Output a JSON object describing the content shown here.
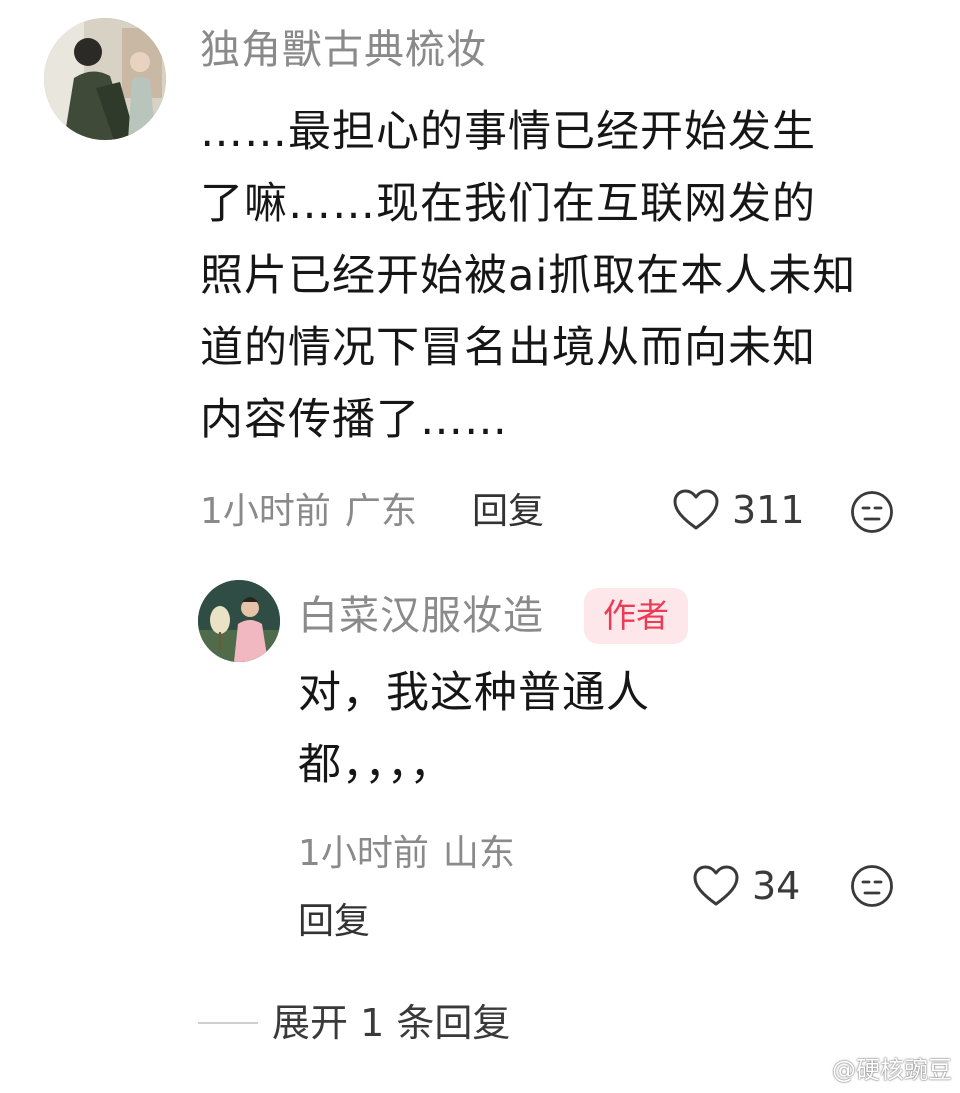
{
  "main_comment": {
    "username": "独角獸古典梳妆",
    "text_lines": [
      "……最担心的事情已经开始发生",
      "了嘛……现在我们在互联网发的",
      "照片已经开始被ai抓取在本人未知",
      "道的情况下冒名出境从而向未知",
      "内容传播了……"
    ],
    "time": "1小时前",
    "location": "广东",
    "reply_label": "回复",
    "likes": "311"
  },
  "reply_comment": {
    "username": "白菜汉服妆造",
    "badge": "作者",
    "text_lines": [
      "对，我这种普通人",
      "都，，，，"
    ],
    "time": "1小时前",
    "location": "山东",
    "reply_label": "回复",
    "likes": "34"
  },
  "expand_replies": {
    "label": "展开 1 条回复"
  },
  "watermark": {
    "text": "@硬核豌豆"
  },
  "colors": {
    "badge_bg": "#fde7ea",
    "badge_text": "#ea3d55",
    "meta_gray": "#8a8a8a"
  },
  "icons": {
    "like": "heart-icon",
    "dislike": "neutral-face-icon",
    "watermark": "weibo-logo-icon"
  }
}
